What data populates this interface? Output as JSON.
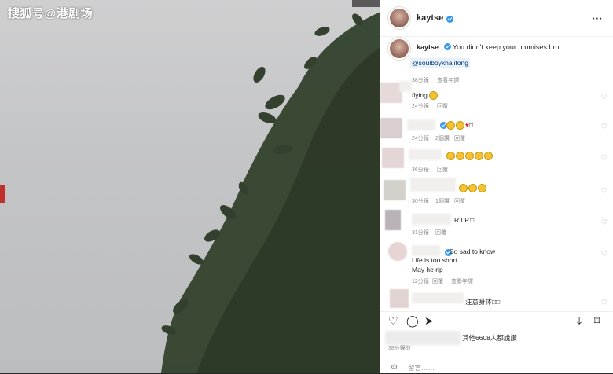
{
  "watermark": "搜狐号@港剧场",
  "post": {
    "username": "kaytse",
    "caption_user": "kaytse",
    "caption_text": "You didn't keep your promises bro",
    "mention": "@soulboykhalifong",
    "caption_time": "38分鐘",
    "caption_action": "查看年譯"
  },
  "comments": [
    {
      "text": "flying",
      "time": "24分鐘",
      "reply": "回覆",
      "likes": ""
    },
    {
      "text": "",
      "time": "24分鐘",
      "likes": "2個讚",
      "reply": "回覆"
    },
    {
      "text": "",
      "time": "36分鐘",
      "reply": "回覆",
      "likes": ""
    },
    {
      "text": "",
      "time": "30分鐘",
      "likes": "1個讚",
      "reply": "回覆"
    },
    {
      "text": "R.I.P.",
      "time": "31分鐘",
      "reply": "回覆",
      "likes": ""
    },
    {
      "text": "So sad to know",
      "line2": "Life is too short",
      "line3": "May he rip",
      "time": "12分鐘",
      "reply": "回覆",
      "translate": "查看年譯"
    },
    {
      "text": "注意身体",
      "time": "",
      "reply": "",
      "likes": ""
    }
  ],
  "likes_text": "其他6608人都說讚",
  "date": "38分鐘前",
  "add_comment_placeholder": "留言……",
  "icons": [
    "heart-icon",
    "comment-icon",
    "share-icon",
    "bookmark-icon",
    "more-icon",
    "smile-icon"
  ],
  "colors": {
    "verified": "#3897f0",
    "link": "#00376b",
    "meta": "#8e8e8e"
  }
}
